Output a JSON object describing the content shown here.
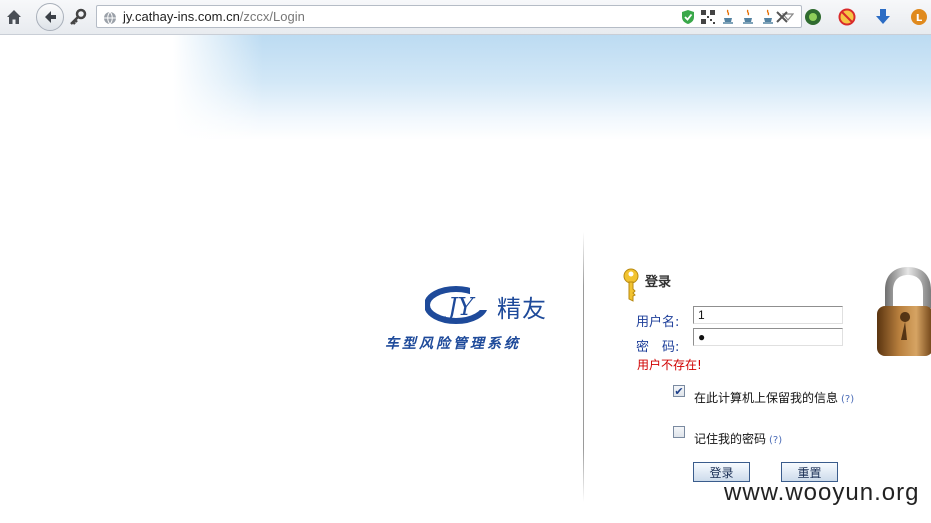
{
  "browser": {
    "url_host": "jy.cathay-ins.com.cn",
    "url_path": "/zccx/Login",
    "icons": [
      "home-icon",
      "back-icon",
      "key-icon",
      "globe-icon",
      "shield-icon",
      "qr-code-icon",
      "java-icon",
      "java-icon",
      "java-icon",
      "dropdown-icon",
      "close-icon",
      "extension-icon",
      "block-icon",
      "download-icon",
      "lastpass-icon"
    ],
    "accent_color": "#2b6cc4"
  },
  "brand": {
    "logo_letters": "JY",
    "name": "精友",
    "subtitle": "车型风险管理系统",
    "color": "#1e4a9a"
  },
  "login": {
    "title": "登录",
    "username_label": "用户名:",
    "username_value": "1",
    "password_label": "密　码:",
    "password_value": "●",
    "error_message": "用户不存在!",
    "error_color": "#d00000",
    "remember_info_label": "在此计算机上保留我的信息",
    "remember_info_checked": true,
    "remember_password_label": "记住我的密码",
    "remember_password_checked": false,
    "help_mark": "(?)",
    "login_button": "登录",
    "reset_button": "重置"
  },
  "watermark": "www.wooyun.org"
}
